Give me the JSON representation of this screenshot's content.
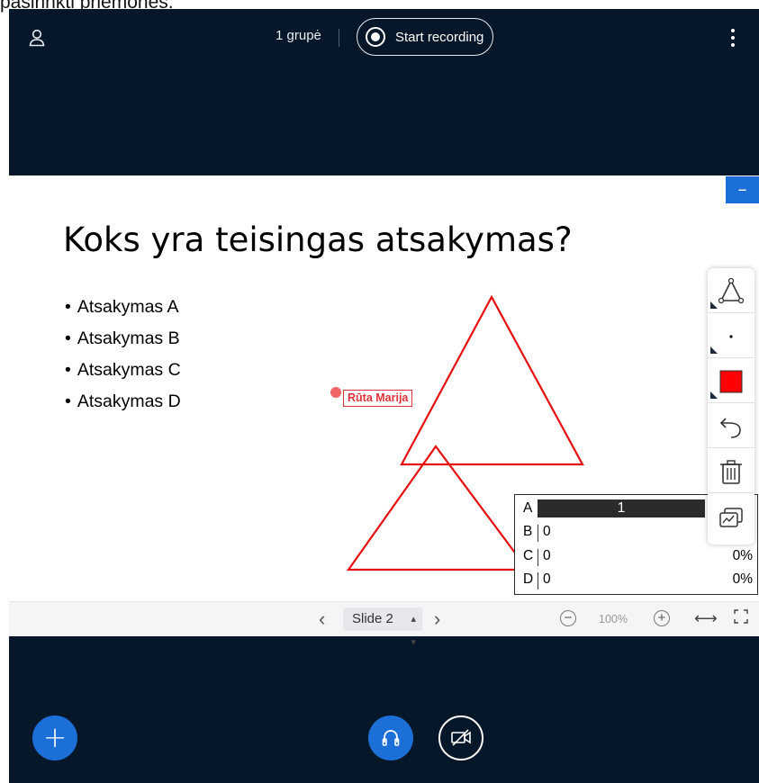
{
  "document": {
    "caption_above": "pasirinkti priemonės."
  },
  "topbar": {
    "group_label": "1 grupė",
    "recording_label": "Start recording"
  },
  "slide": {
    "title": "Koks yra teisingas atsakymas?",
    "bullets": [
      "Atsakymas A",
      "Atsakymas B",
      "Atsakymas C",
      "Atsakymas D"
    ],
    "cursor_user": "Rūta Marija"
  },
  "poll": {
    "rows": [
      {
        "letter": "A",
        "count": "1",
        "percent": ""
      },
      {
        "letter": "B",
        "count": "0",
        "percent": ""
      },
      {
        "letter": "C",
        "count": "0",
        "percent": "0%"
      },
      {
        "letter": "D",
        "count": "0",
        "percent": "0%"
      }
    ]
  },
  "tools": [
    "triangle-shape-icon",
    "pencil-thickness-icon",
    "color-icon",
    "undo-icon",
    "trash-icon",
    "multi-user-icon"
  ],
  "tool_color": "#ff0000",
  "navbar": {
    "slide_label": "Slide 2",
    "zoom": "100%"
  },
  "colors": {
    "background": "#06172a",
    "accent": "#1b6fd6",
    "annotation": "#e0313a"
  }
}
